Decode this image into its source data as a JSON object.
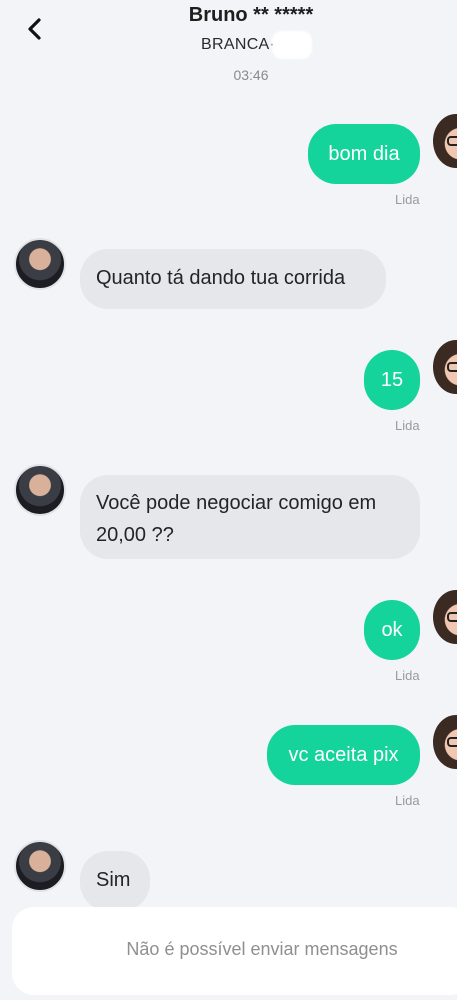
{
  "header": {
    "back_icon": "chevron-left-icon",
    "title": "Bruno ** *****",
    "plate": "BRANCA·N   3",
    "time": "03:46"
  },
  "messages": [
    {
      "dir": "out",
      "text": "bom dia",
      "status": "Lida"
    },
    {
      "dir": "in",
      "text": "Quanto tá dando tua corrida"
    },
    {
      "dir": "out",
      "text": "15",
      "status": "Lida"
    },
    {
      "dir": "in",
      "text_line1": "Você pode negociar comigo em",
      "text_line2": "20,00 ??"
    },
    {
      "dir": "out",
      "text": "ok",
      "status": "Lida"
    },
    {
      "dir": "out",
      "text": "vc aceita pix",
      "status": "Lida"
    },
    {
      "dir": "in",
      "text": "Sim"
    }
  ],
  "footer": {
    "disabled_text": "Não é possível enviar mensagens"
  },
  "colors": {
    "outgoing_bubble": "#14d39b",
    "incoming_bubble": "#e6e7eb",
    "background": "#f2f4f7"
  }
}
